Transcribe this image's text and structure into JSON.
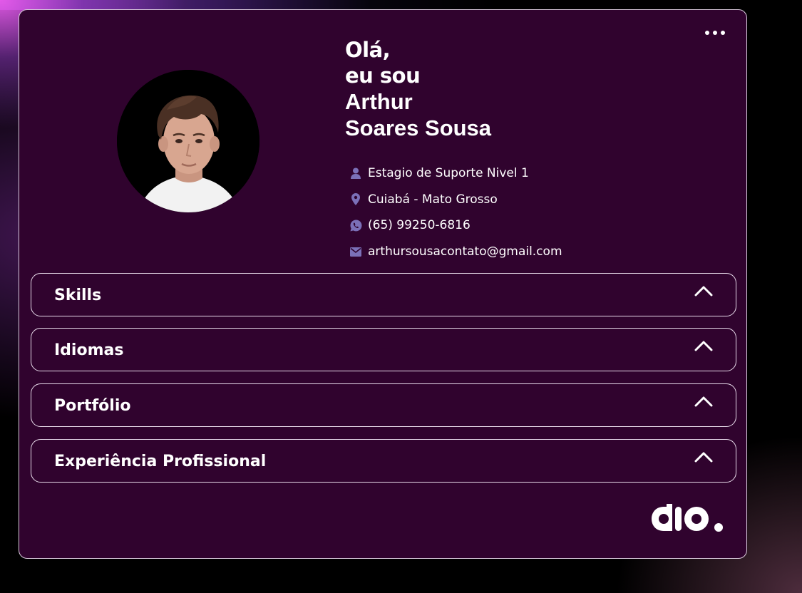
{
  "profile": {
    "greeting_line1": "Olá,",
    "greeting_line2": "eu sou",
    "first_name": "Arthur",
    "last_name": "Soares Sousa",
    "avatar_alt": "Foto de perfil"
  },
  "info": [
    {
      "icon": "user-icon",
      "text": "Estagio de Suporte Nivel 1"
    },
    {
      "icon": "location-pin-icon",
      "text": "Cuiabá - Mato Grosso"
    },
    {
      "icon": "whatsapp-icon",
      "text": "(65) 99250-6816"
    },
    {
      "icon": "mail-icon",
      "text": "arthursousacontato@gmail.com"
    }
  ],
  "sections": [
    {
      "title": "Skills"
    },
    {
      "title": "Idiomas"
    },
    {
      "title": "Portfólio"
    },
    {
      "title": "Experiência Profissional"
    }
  ],
  "colors": {
    "card_background": "#30032e",
    "icon_accent": "#7b70b8",
    "border": "#e8dceb"
  },
  "logo": {
    "name": "dio-logo"
  }
}
